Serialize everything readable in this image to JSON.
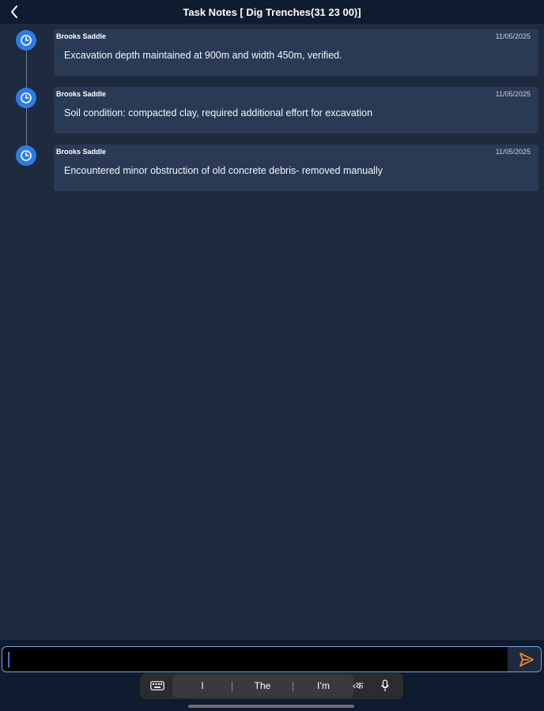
{
  "header": {
    "title": "Task Notes [ Dig Trenches(31 23 00)]",
    "back_icon": "chevron-left-icon"
  },
  "notes": [
    {
      "author": "Brooks Saddle",
      "date": "11/05/2025",
      "text": "Excavation depth maintained at 900m and width 450m, verified.",
      "icon": "clock-icon"
    },
    {
      "author": "Brooks Saddle",
      "date": "11/05/2025",
      "text": "Soil condition: compacted clay, required additional effort for excavation",
      "icon": "clock-icon"
    },
    {
      "author": "Brooks Saddle",
      "date": "11/05/2025",
      "text": "Encountered minor obstruction of old concrete debris- removed manually",
      "icon": "clock-icon"
    }
  ],
  "composer": {
    "value": "",
    "placeholder": "",
    "send_icon": "send-icon"
  },
  "keyboard": {
    "suggestions": [
      "I",
      "The",
      "I’m"
    ],
    "language_key": "क",
    "icons": [
      "keyboard-icon",
      "microphone-icon"
    ]
  },
  "colors": {
    "background": "#1f2a3e",
    "header": "#0f1b2e",
    "card": "#2a3a55",
    "accent": "#2f7be6",
    "send": "#f08a24"
  }
}
